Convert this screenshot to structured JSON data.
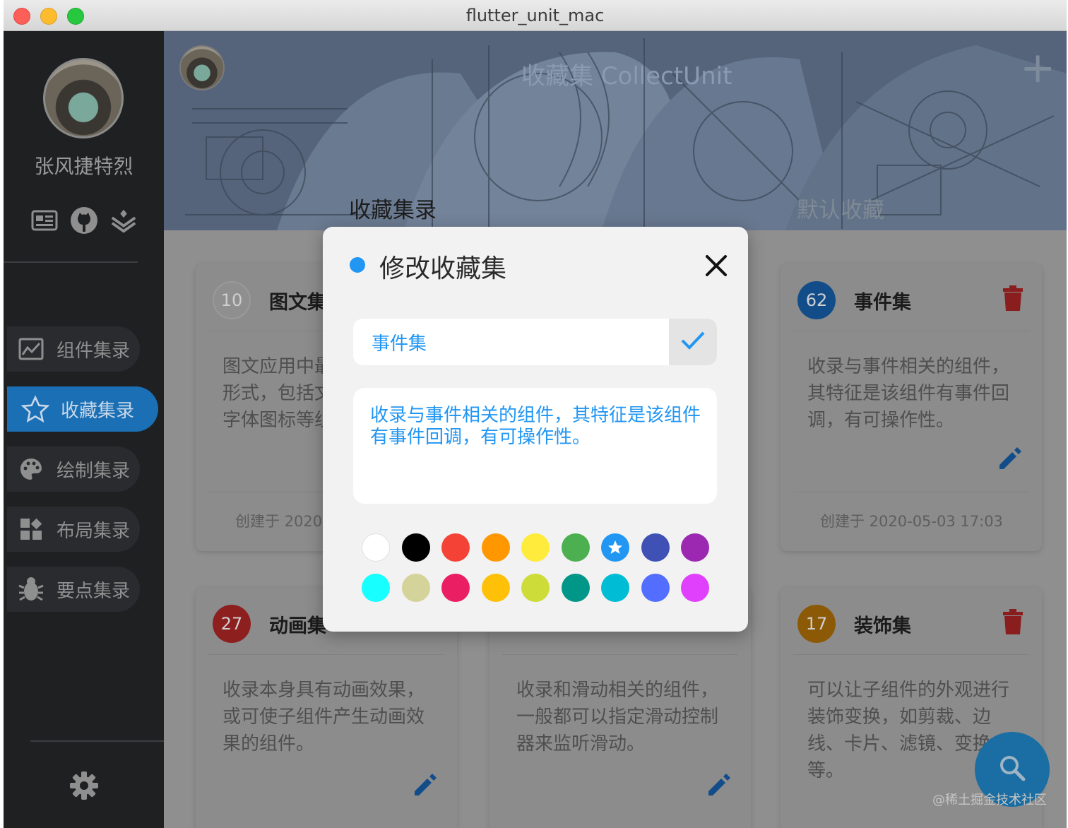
{
  "window": {
    "title": "flutter_unit_mac"
  },
  "sidebar": {
    "username": "张风捷特烈",
    "top_icons": [
      "card-icon",
      "github-icon",
      "layers-icon"
    ],
    "items": [
      {
        "label": "组件集录",
        "icon": "chart-icon",
        "active": false
      },
      {
        "label": "收藏集录",
        "icon": "star-icon",
        "active": true
      },
      {
        "label": "绘制集录",
        "icon": "palette-icon",
        "active": false
      },
      {
        "label": "布局集录",
        "icon": "dashboard-icon",
        "active": false
      },
      {
        "label": "要点集录",
        "icon": "bug-icon",
        "active": false
      }
    ],
    "settings_icon": "gear-icon"
  },
  "header": {
    "title": "收藏集 CollectUnit",
    "add_label": "+",
    "tabs": [
      {
        "label": "收藏集录",
        "active": true
      },
      {
        "label": "默认收藏",
        "active": false
      }
    ]
  },
  "cards": [
    {
      "count": "10",
      "title": "图文集",
      "desc": "图文应用中最常见的组件形式，包括文字、图片、字体图标等组件。",
      "date": "创建于 2020",
      "color": "#8f8f8f"
    },
    {
      "count": "62",
      "title": "事件集",
      "desc": "收录与事件相关的组件，其特征是该组件有事件回调，有可操作性。",
      "date": "创建于 2020-05-03 17:03",
      "color": "#124d8a"
    },
    {
      "count": "27",
      "title": "动画集",
      "desc": "收录本身具有动画效果，或可使子组件产生动画效果的组件。",
      "date": "",
      "color": "#8e1f1f"
    },
    {
      "count": "",
      "title": "",
      "desc": "收录和滑动相关的组件，一般都可以指定滑动控制器来监听滑动。",
      "date": "",
      "color": "#7f851c"
    },
    {
      "count": "17",
      "title": "装饰集",
      "desc": "可以让子组件的外观进行装饰变换，如剪裁、边线、卡片、滤镜、变换等。",
      "date": "",
      "color": "#8c5a07"
    }
  ],
  "dialog": {
    "title": "修改收藏集",
    "name_value": "事件集",
    "description": "收录与事件相关的组件，其特征是该组件有事件回调，有可操作性。",
    "accent": "#2196f3",
    "selected_color": "#2196f3",
    "colors": [
      "#ffffff",
      "#000000",
      "#f44336",
      "#ff9800",
      "#ffeb3b",
      "#4caf50",
      "#2196f3",
      "#3f51b5",
      "#9c27b0",
      "#18ffff",
      "#d4d39a",
      "#e91e63",
      "#ffc107",
      "#cddc39",
      "#009688",
      "#00bcd4",
      "#536dfe",
      "#e040fb"
    ]
  },
  "fab": {
    "icon": "search-icon"
  },
  "watermark": "@稀土掘金技术社区"
}
